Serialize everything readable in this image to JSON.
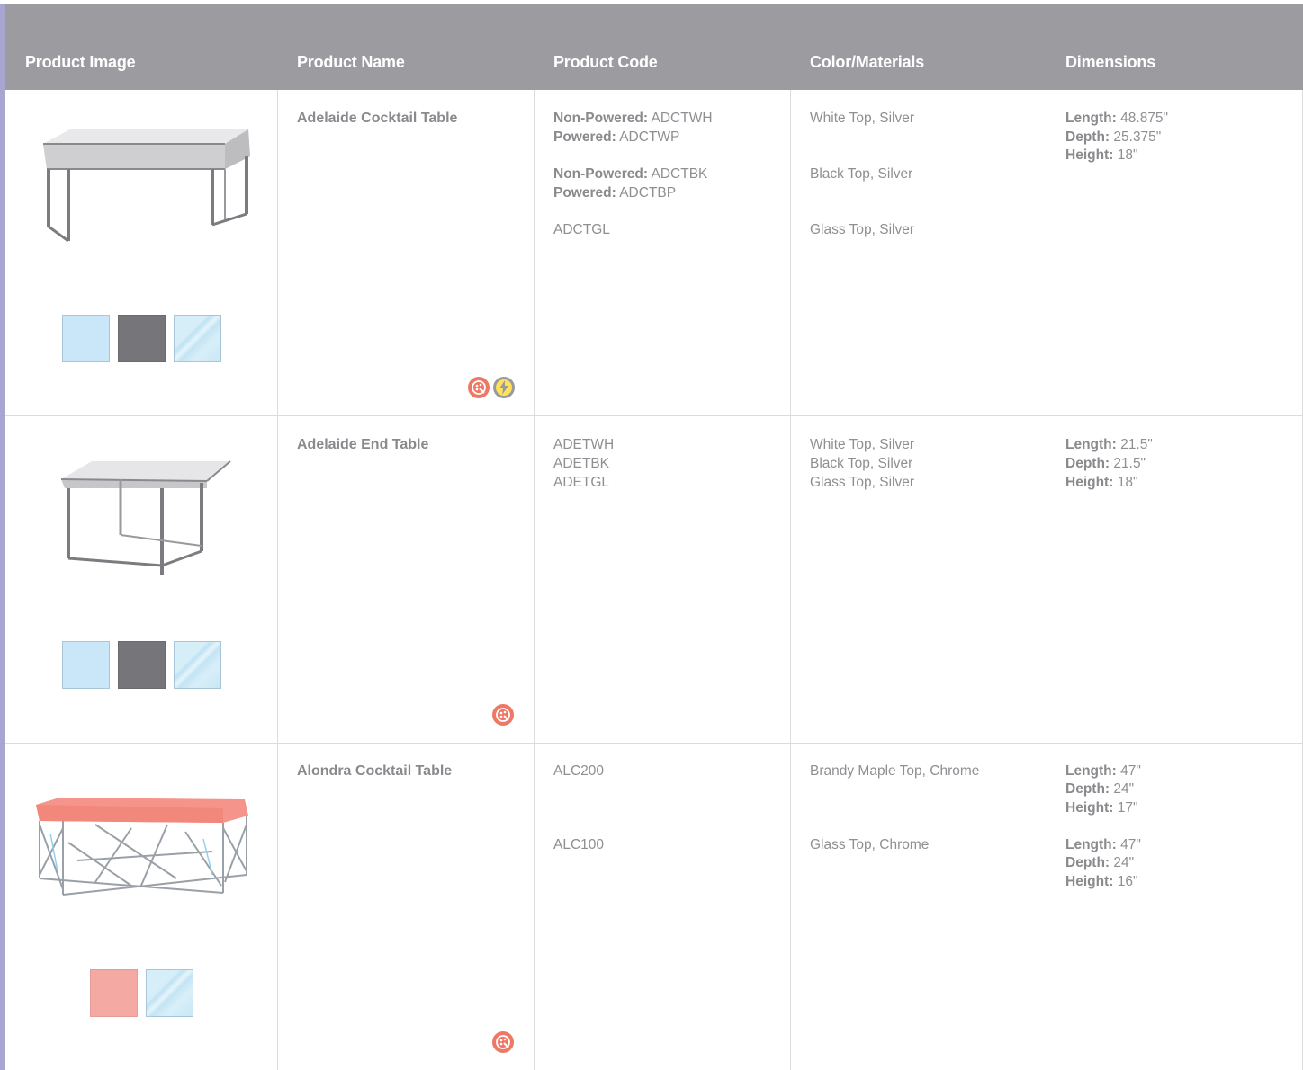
{
  "header": {
    "col_image": "Product Image",
    "col_name": "Product Name",
    "col_code": "Product Code",
    "col_color": "Color/Materials",
    "col_dims": "Dimensions"
  },
  "labels": {
    "non_powered": "Non-Powered:",
    "powered": "Powered:",
    "length": "Length:",
    "depth": "Depth:",
    "height": "Height:"
  },
  "products": [
    {
      "name": "Adelaide Cocktail Table",
      "image_icon": "cocktail-table-image",
      "swatches": [
        "white",
        "black",
        "glass"
      ],
      "badges": [
        "customizable-icon",
        "powered-icon"
      ],
      "codes": [
        {
          "non_powered": "ADCTWH",
          "powered": "ADCTWP"
        },
        {
          "non_powered": "ADCTBK",
          "powered": "ADCTBP"
        },
        {
          "code": "ADCTGL"
        }
      ],
      "colors": [
        "White Top, Silver",
        "Black Top, Silver",
        "Glass Top, Silver"
      ],
      "dimensions": [
        {
          "length": "48.875\"",
          "depth": "25.375\"",
          "height": "18\""
        }
      ]
    },
    {
      "name": "Adelaide End Table",
      "image_icon": "end-table-image",
      "swatches": [
        "white",
        "black",
        "glass"
      ],
      "badges": [
        "customizable-icon"
      ],
      "codes": [
        "ADETWH",
        "ADETBK",
        "ADETGL"
      ],
      "colors": [
        "White Top, Silver",
        "Black Top, Silver",
        "Glass Top, Silver"
      ],
      "dimensions": [
        {
          "length": "21.5\"",
          "depth": "21.5\"",
          "height": "18\""
        }
      ]
    },
    {
      "name": "Alondra Cocktail Table",
      "image_icon": "geometric-cocktail-table-image",
      "swatches": [
        "brandy-maple",
        "glass"
      ],
      "badges": [
        "customizable-icon"
      ],
      "codes": [
        "ALC200",
        "ALC100"
      ],
      "colors": [
        "Brandy Maple Top, Chrome",
        "Glass Top, Chrome"
      ],
      "dimensions": [
        {
          "length": "47\"",
          "depth": "24\"",
          "height": "17\""
        },
        {
          "length": "47\"",
          "depth": "24\"",
          "height": "16\""
        }
      ]
    }
  ],
  "colors": {
    "header_bg": "#9c9ca0",
    "left_accent": "#a6a6d0",
    "swatch_white": "#c9e7f8",
    "swatch_black": "#76767a",
    "swatch_maple": "#f4a9a3",
    "badge_custom": "#ee7866",
    "badge_power": "#9a9a9e"
  }
}
